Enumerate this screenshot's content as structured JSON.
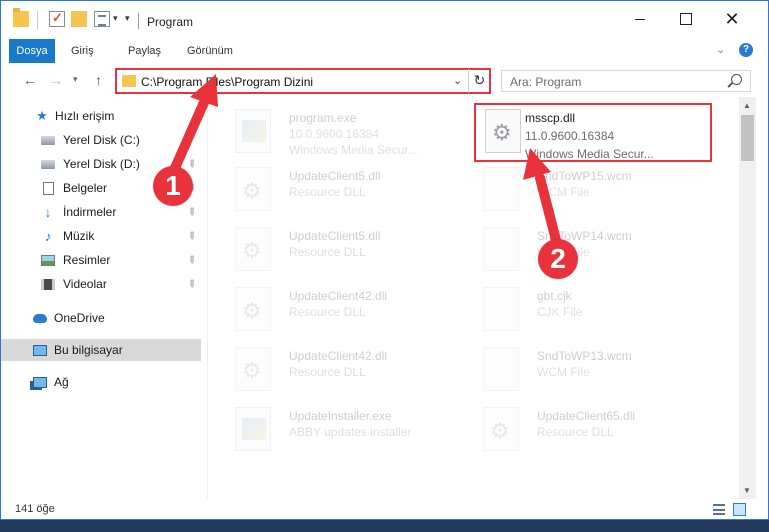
{
  "window": {
    "title": "Program",
    "close_glyph": "✕"
  },
  "ribbon": {
    "tabs": [
      "Dosya",
      "Giriş",
      "Paylaş",
      "Görünüm"
    ],
    "help_glyph": "?"
  },
  "nav": {
    "back_glyph": "←",
    "forward_glyph": "→",
    "up_glyph": "↑",
    "refresh_glyph": "↻"
  },
  "address": {
    "path": "C:\\Program Files\\Program Dizini"
  },
  "search": {
    "placeholder": "Ara: Program"
  },
  "sidebar": {
    "items": [
      {
        "label": "Hızlı erişim",
        "icon": "quick-access-star-icon"
      },
      {
        "label": "Yerel Disk (C:)",
        "icon": "drive-icon"
      },
      {
        "label": "Yerel Disk (D:)",
        "icon": "drive-icon",
        "pinned": true
      },
      {
        "label": "Belgeler",
        "icon": "documents-icon",
        "pinned": true
      },
      {
        "label": "İndirmeler",
        "icon": "downloads-icon",
        "pinned": true
      },
      {
        "label": "Müzik",
        "icon": "music-icon",
        "pinned": true
      },
      {
        "label": "Resimler",
        "icon": "pictures-icon",
        "pinned": true
      },
      {
        "label": "Videolar",
        "icon": "videos-icon",
        "pinned": true
      },
      {
        "label": "OneDrive",
        "icon": "onedrive-cloud-icon"
      },
      {
        "label": "Bu bilgisayar",
        "icon": "this-pc-icon",
        "selected": true
      },
      {
        "label": "Ağ",
        "icon": "network-icon"
      }
    ]
  },
  "files": [
    {
      "name": "program.exe",
      "line2": "10.0.9600.16384",
      "line3": "Windows Media Secur...",
      "kind": "exe",
      "faded": true
    },
    {
      "name": "msscp.dll",
      "line2": "11.0.9600.16384",
      "line3": "Windows Media Secur...",
      "kind": "dll",
      "faded": false,
      "highlighted": true
    },
    {
      "name": "UpdateClient5.dll",
      "line2": "Resource DLL",
      "kind": "dll",
      "faded": true
    },
    {
      "name": "SndToWP15.wcm",
      "line2": "WCM File",
      "kind": "doc",
      "faded": true
    },
    {
      "name": "UpdateClient5.dll",
      "line2": "Resource DLL",
      "kind": "dll",
      "faded": true
    },
    {
      "name": "SndToWP14.wcm",
      "line2": "WCM File",
      "kind": "doc",
      "faded": true
    },
    {
      "name": "UpdateClient42.dll",
      "line2": "Resource DLL",
      "kind": "dll",
      "faded": true
    },
    {
      "name": "gbt.cjk",
      "line2": "CJK File",
      "kind": "doc",
      "faded": true
    },
    {
      "name": "UpdateClient42.dll",
      "line2": "Resource DLL",
      "kind": "dll",
      "faded": true
    },
    {
      "name": "SndToWP13.wcm",
      "line2": "WCM File",
      "kind": "doc",
      "faded": true
    },
    {
      "name": "UpdateInstaller.exe",
      "line2": "ABBY updates installer",
      "kind": "exe",
      "faded": true
    },
    {
      "name": "UpdateClient65.dll",
      "line2": "Resource DLL",
      "kind": "dll",
      "faded": true
    }
  ],
  "status": {
    "item_count": "141 öğe"
  },
  "annotations": {
    "callout_1": "1",
    "callout_2": "2",
    "accent_color": "#e8323c"
  }
}
